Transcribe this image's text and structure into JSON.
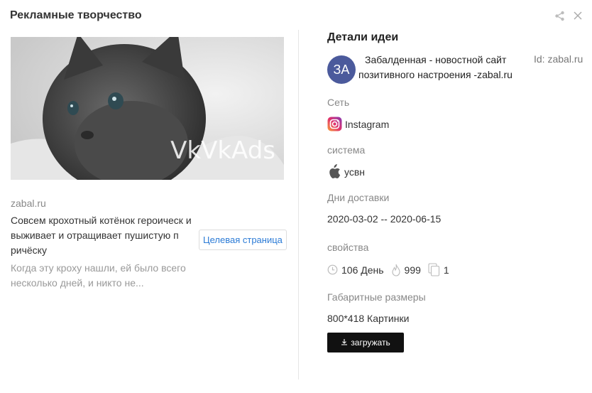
{
  "header": {
    "title": "Рекламные творчество"
  },
  "creative": {
    "image_alt": "kitten",
    "watermark": "VkVkAds",
    "domain": "zabal.ru",
    "text": "Совсем крохотный котёнок героически выживает и отращивает пушистую причёску",
    "text_display": "Совсем крохотный котёнок героическ и выживает и отращивает пушистую п ричёску",
    "landing_button": "Целевая страница",
    "description": "Когда эту кроху нашли, ей было всего несколько дней, и никто не..."
  },
  "details": {
    "title": "Детали идеи",
    "advertiser": {
      "avatar": "ЗА",
      "name": "Забалденная - новостной сайт позитивного настроения -zabal.ru",
      "id": "Id: zabal.ru"
    },
    "network_label": "Сеть",
    "network_value": "Instagram",
    "system_label": "система",
    "system_value": "усвн",
    "delivery_label": "Дни доставки",
    "delivery_value": "2020-03-02 -- 2020-06-15",
    "props_label": "свойства",
    "props": {
      "days": "106 День",
      "heat": "999",
      "copies": "1"
    },
    "size_label": "Габаритные размеры",
    "size_value": "800*418 Картинки",
    "download_button": "загружать"
  },
  "icons": {
    "share": "share-icon",
    "close": "close-icon",
    "instagram": "instagram-icon",
    "apple": "apple-icon",
    "clock": "clock-icon",
    "fire": "fire-icon",
    "copy": "copy-icon",
    "download": "download-icon"
  },
  "colors": {
    "avatar_bg": "#4b5a9c",
    "link": "#2b7bd6",
    "download_bg": "#111111"
  }
}
